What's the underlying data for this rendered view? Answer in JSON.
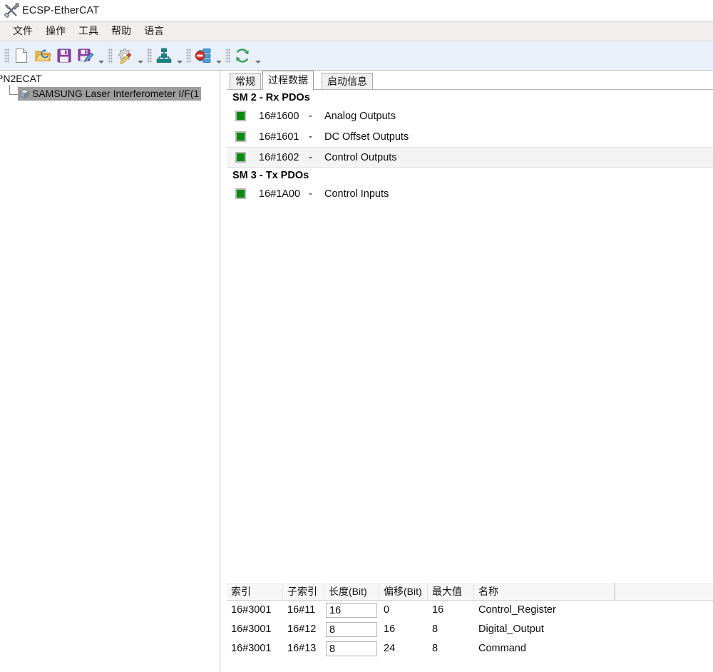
{
  "window": {
    "title": "ECSP-EtherCAT",
    "icon": "tools-icon"
  },
  "menubar": {
    "items": [
      {
        "label": "文件",
        "name": "menu-file"
      },
      {
        "label": "操作",
        "name": "menu-operation"
      },
      {
        "label": "工具",
        "name": "menu-tools"
      },
      {
        "label": "帮助",
        "name": "menu-help"
      },
      {
        "label": "语言",
        "name": "menu-language"
      }
    ]
  },
  "toolbar": {
    "buttons": [
      {
        "name": "new-file-icon",
        "tip": "新建"
      },
      {
        "name": "open-folder-icon",
        "tip": "打开"
      },
      {
        "name": "save-icon",
        "tip": "保存"
      },
      {
        "name": "save-as-icon",
        "tip": "另存为"
      },
      {
        "name": "configure-icon",
        "tip": "配置"
      },
      {
        "name": "network-scan-icon",
        "tip": "扫描网络"
      },
      {
        "name": "network-stop-icon",
        "tip": "停止"
      },
      {
        "name": "refresh-icon",
        "tip": "刷新"
      }
    ]
  },
  "tree": {
    "root_label": "PN2ECAT",
    "child_label": "SAMSUNG Laser Interferometer I/F(1",
    "child_icon": "device-node-icon",
    "child_selected": true
  },
  "tabs": [
    {
      "label": "常规",
      "name": "tab-general",
      "active": false
    },
    {
      "label": "过程数据",
      "name": "tab-process-data",
      "active": true
    },
    {
      "label": "启动信息",
      "name": "tab-startup-info",
      "active": false
    }
  ],
  "pdo_groups": [
    {
      "title": "SM 2 - Rx PDOs",
      "rows": [
        {
          "index": "16#1600",
          "dash": "-",
          "name": "Analog Outputs",
          "checked": true,
          "selected": false
        },
        {
          "index": "16#1601",
          "dash": "-",
          "name": "DC Offset Outputs",
          "checked": true,
          "selected": false
        },
        {
          "index": "16#1602",
          "dash": "-",
          "name": "Control Outputs",
          "checked": true,
          "selected": true
        }
      ]
    },
    {
      "title": "SM 3 - Tx PDOs",
      "rows": [
        {
          "index": "16#1A00",
          "dash": "-",
          "name": "Control Inputs",
          "checked": true,
          "selected": false
        }
      ]
    }
  ],
  "table": {
    "columns": [
      {
        "label": "索引",
        "name": "col-index"
      },
      {
        "label": "子索引",
        "name": "col-subindex"
      },
      {
        "label": "长度(Bit)",
        "name": "col-length-bit"
      },
      {
        "label": "偏移(Bit)",
        "name": "col-offset-bit"
      },
      {
        "label": "最大值",
        "name": "col-max-value"
      },
      {
        "label": "名称",
        "name": "col-name"
      }
    ],
    "rows": [
      {
        "index": "16#3001",
        "subindex": "16#11",
        "length": "16",
        "offset": "0",
        "max": "16",
        "name": "Control_Register"
      },
      {
        "index": "16#3001",
        "subindex": "16#12",
        "length": "8",
        "offset": "16",
        "max": "8",
        "name": "Digital_Output"
      },
      {
        "index": "16#3001",
        "subindex": "16#13",
        "length": "8",
        "offset": "24",
        "max": "8",
        "name": "Command"
      }
    ]
  },
  "colors": {
    "pdo_checked_green": "#0b8a12",
    "toolbar_background": "#e9f0fa",
    "menubar_background": "#f0efee",
    "tree_selection": "#9d9d9d",
    "row_selection": "#f4f4f4"
  }
}
